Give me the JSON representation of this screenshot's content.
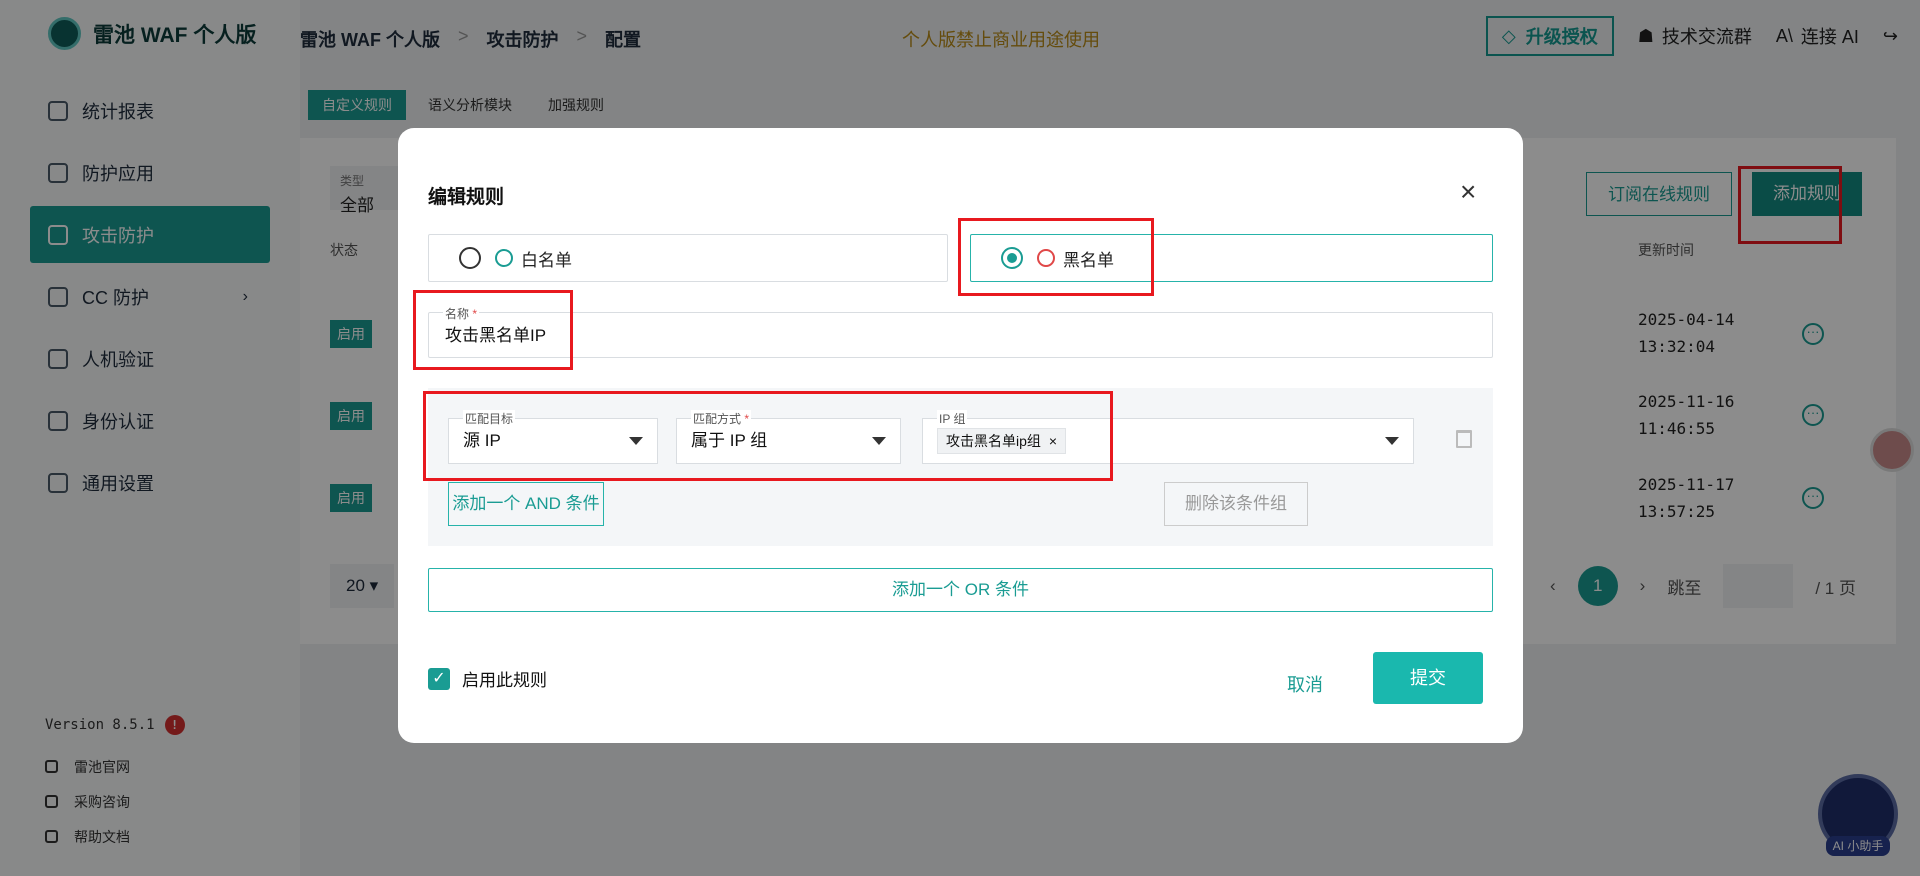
{
  "app": {
    "title": "雷池 WAF 个人版"
  },
  "sidebar": {
    "items": [
      {
        "label": "统计报表"
      },
      {
        "label": "防护应用"
      },
      {
        "label": "攻击防护"
      },
      {
        "label": "CC 防护"
      },
      {
        "label": "人机验证"
      },
      {
        "label": "身份认证"
      },
      {
        "label": "通用设置"
      }
    ],
    "version": "Version 8.5.1",
    "version_badge": "!",
    "links": [
      {
        "label": "雷池官网"
      },
      {
        "label": "采购咨询"
      },
      {
        "label": "帮助文档"
      }
    ]
  },
  "header": {
    "breadcrumb": [
      "雷池 WAF 个人版",
      "攻击防护",
      "配置"
    ],
    "breadcrumb_sep": ">",
    "notice": "个人版禁止商业用途使用",
    "upgrade": "升级授权",
    "community": "技术交流群",
    "connect_ai": "连接 AI"
  },
  "page": {
    "tabs": [
      "自定义规则",
      "语义分析模块",
      "加强规则"
    ],
    "filter_type_label": "类型",
    "filter_type_value": "全部",
    "subscribe_btn": "订阅在线规则",
    "add_rule_btn": "添加规则",
    "col_status": "状态",
    "col_updated": "更新时间",
    "rows": [
      {
        "status": "启用",
        "date": "2025-04-14",
        "time": "13:32:04"
      },
      {
        "status": "启用",
        "date": "2025-11-16",
        "time": "11:46:55"
      },
      {
        "status": "启用",
        "date": "2025-11-17",
        "time": "13:57:25"
      }
    ],
    "page_size": "20",
    "current_page": "1",
    "jump_label": "跳至",
    "total_pages": "/ 1 页"
  },
  "modal": {
    "title": "编辑规则",
    "whitelist": "白名单",
    "blacklist": "黑名单",
    "selected_list": "blacklist",
    "name_label": "名称",
    "name_value": "攻击黑名单IP",
    "match_target_label": "匹配目标",
    "match_target_value": "源 IP",
    "match_method_label": "匹配方式",
    "match_method_value": "属于 IP 组",
    "ip_group_label": "IP 组",
    "ip_group_tag": "攻击黑名单ip组",
    "add_and": "添加一个 AND 条件",
    "delete_group": "删除该条件组",
    "add_or": "添加一个 OR 条件",
    "enable_label": "启用此规则",
    "enabled": true,
    "cancel": "取消",
    "submit": "提交"
  },
  "assistant": {
    "label": "AI 小助手"
  },
  "colors": {
    "accent": "#1a9c93",
    "highlight": "#e8191f"
  }
}
